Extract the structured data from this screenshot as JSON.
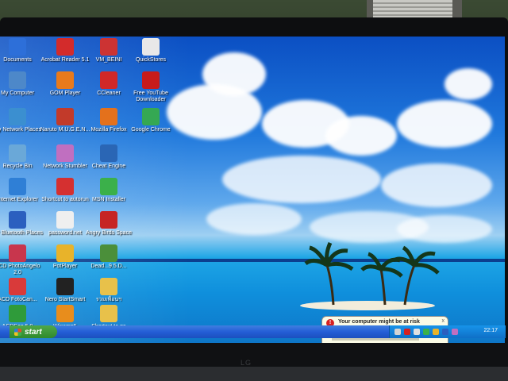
{
  "desktop": {
    "icons": [
      {
        "label": "Documents",
        "icon": "folder-icon",
        "color": "#2d6fd9"
      },
      {
        "label": "Acrobat Reader 5.1",
        "icon": "acrobat-icon",
        "color": "#d32b2b"
      },
      {
        "label": "VM_BEINI",
        "icon": "vm-icon",
        "color": "#cc3333"
      },
      {
        "label": "QuickStores",
        "icon": "quickstores-icon",
        "color": "#e8e8e8"
      },
      {
        "label": "My Computer",
        "icon": "computer-icon",
        "color": "#4d88c9"
      },
      {
        "label": "GOM Player",
        "icon": "gom-player-icon",
        "color": "#e87a1c"
      },
      {
        "label": "CCleaner",
        "icon": "ccleaner-icon",
        "color": "#d02828"
      },
      {
        "label": "Free YouTube Downloader",
        "icon": "youtube-downloader-icon",
        "color": "#c81b1b"
      },
      {
        "label": "My Network Places",
        "icon": "network-places-icon",
        "color": "#3b8fd0"
      },
      {
        "label": "Naruto M.U.G.E.N...",
        "icon": "naruto-icon",
        "color": "#c23a2a"
      },
      {
        "label": "Mozilla Firefox",
        "icon": "firefox-icon",
        "color": "#e4711c"
      },
      {
        "label": "Google Chrome",
        "icon": "chrome-icon",
        "color": "#35a853"
      },
      {
        "label": "Recycle Bin",
        "icon": "recycle-bin-icon",
        "color": "#6aa8d8"
      },
      {
        "label": "Network Stumbler",
        "icon": "network-stumbler-icon",
        "color": "#c06fc0"
      },
      {
        "label": "Cheat Engine",
        "icon": "cheat-engine-icon",
        "color": "#2a66b5"
      },
      {
        "label": "Internet Explorer",
        "icon": "internet-explorer-icon",
        "color": "#2f7fd6"
      },
      {
        "label": "Shortcut to autorun",
        "icon": "autorun-icon",
        "color": "#d53030"
      },
      {
        "label": "MSN Installer",
        "icon": "msn-icon",
        "color": "#3bb04a"
      },
      {
        "label": "My Bluetooth Places",
        "icon": "bluetooth-icon",
        "color": "#2b5fbf"
      },
      {
        "label": "password.net",
        "icon": "text-file-icon",
        "color": "#efefef"
      },
      {
        "label": "Angry Birds Space",
        "icon": "angry-birds-icon",
        "color": "#c62424"
      },
      {
        "label": "ACD PhotoAngelo 2.0",
        "icon": "acd-photoangelo-icon",
        "color": "#c8364d"
      },
      {
        "label": "PotPlayer",
        "icon": "potplayer-icon",
        "color": "#e8b32a"
      },
      {
        "label": "Dead...9.5.D...",
        "icon": "game-icon",
        "color": "#4b8f3a"
      },
      {
        "label": "ACD FotoCan...",
        "icon": "acd-fotocanvas-icon",
        "color": "#d93a3a"
      },
      {
        "label": "Nero StartSmart",
        "icon": "nero-icon",
        "color": "#222222"
      },
      {
        "label": "รวมเพื่อนฯ",
        "icon": "folder-icon",
        "color": "#e8c14a"
      },
      {
        "label": "ACDSee 5.0",
        "icon": "acdsee-icon",
        "color": "#2f9b3a"
      },
      {
        "label": "Winamp5",
        "icon": "winamp-icon",
        "color": "#e88d1c"
      },
      {
        "label": "Shortcut to ga",
        "icon": "folder-icon",
        "color": "#e8c14a"
      }
    ]
  },
  "taskbar": {
    "start_label": "start",
    "clock": "22:17"
  },
  "notification": {
    "title": "Your computer might be at risk",
    "close": "x"
  },
  "monitor": {
    "brand": "LG"
  }
}
